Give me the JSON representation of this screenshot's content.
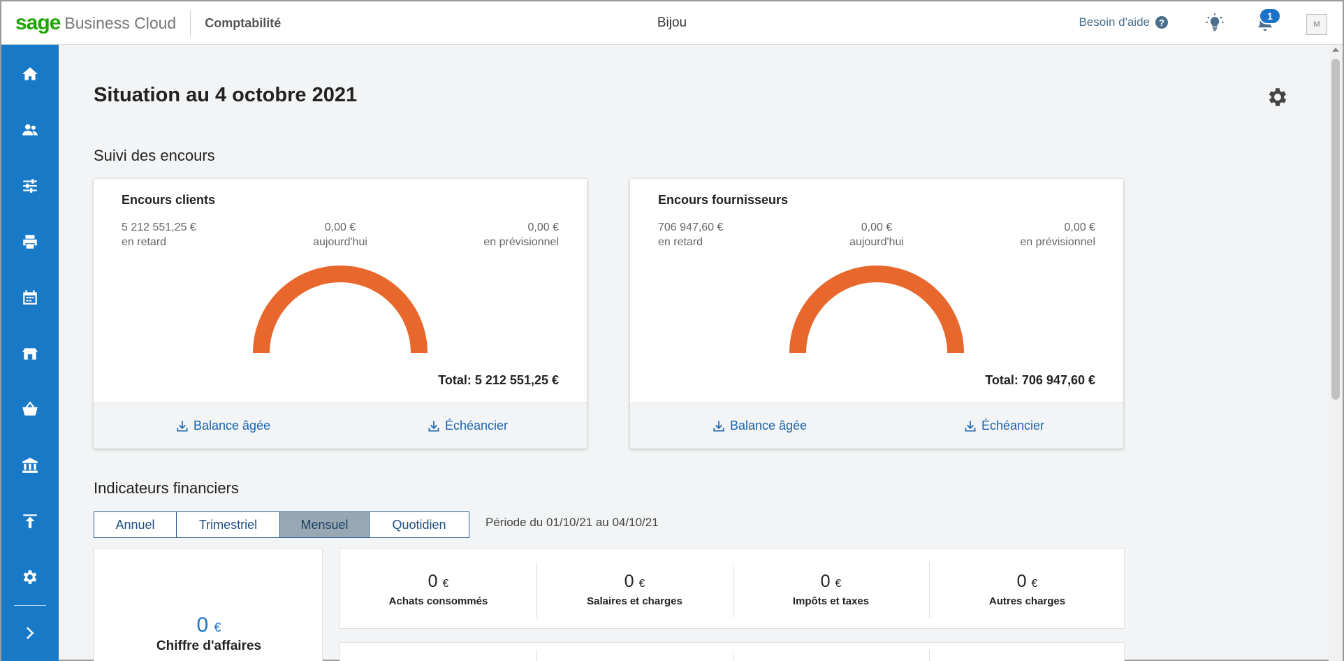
{
  "header": {
    "brand": "sage",
    "product": "Business Cloud",
    "module": "Comptabilité",
    "company": "Bijou",
    "help_label": "Besoin d'aide",
    "notification_count": "1",
    "avatar_initial": "M"
  },
  "sidebar": {
    "items": [
      {
        "icon": "home-icon"
      },
      {
        "icon": "contacts-icon"
      },
      {
        "icon": "settings-sliders-icon"
      },
      {
        "icon": "printer-icon"
      },
      {
        "icon": "calendar-icon"
      },
      {
        "icon": "sales-icon"
      },
      {
        "icon": "purchases-basket-icon"
      },
      {
        "icon": "bank-icon"
      },
      {
        "icon": "upload-icon"
      },
      {
        "icon": "gear-icon"
      },
      {
        "icon": "chevron-right-icon"
      }
    ]
  },
  "page": {
    "title": "Situation au 4 octobre 2021",
    "section_encours": "Suivi des encours",
    "section_indicateurs": "Indicateurs financiers"
  },
  "cards": {
    "clients": {
      "title": "Encours clients",
      "late_value": "5 212 551,25 €",
      "late_label": "en retard",
      "today_value": "0,00 €",
      "today_label": "aujourd'hui",
      "forecast_value": "0,00 €",
      "forecast_label": "en prévisionnel",
      "total": "Total: 5 212 551,25 €",
      "link_balance": "Balance âgée",
      "link_echeancier": "Échéancier"
    },
    "fournisseurs": {
      "title": "Encours fournisseurs",
      "late_value": "706 947,60 €",
      "late_label": "en retard",
      "today_value": "0,00 €",
      "today_label": "aujourd'hui",
      "forecast_value": "0,00 €",
      "forecast_label": "en prévisionnel",
      "total": "Total: 706 947,60 €",
      "link_balance": "Balance âgée",
      "link_echeancier": "Échéancier"
    }
  },
  "period_tabs": {
    "annuel": "Annuel",
    "trimestriel": "Trimestriel",
    "mensuel": "Mensuel",
    "quotidien": "Quotidien",
    "active": "Mensuel"
  },
  "period_text": "Période du 01/10/21 au 04/10/21",
  "indicators": {
    "chiffre_affaires": {
      "value": "0",
      "currency": "€",
      "label": "Chiffre d'affaires"
    },
    "achats": {
      "value": "0",
      "currency": "€",
      "label": "Achats consommés"
    },
    "salaires": {
      "value": "0",
      "currency": "€",
      "label": "Salaires et charges"
    },
    "impots": {
      "value": "0",
      "currency": "€",
      "label": "Impôts et taxes"
    },
    "autres": {
      "value": "0",
      "currency": "€",
      "label": "Autres charges"
    }
  },
  "colors": {
    "brand_green": "#1ea600",
    "sidebar_blue": "#1879c7",
    "gauge_orange": "#e8672d",
    "link_blue": "#1a64ad"
  }
}
